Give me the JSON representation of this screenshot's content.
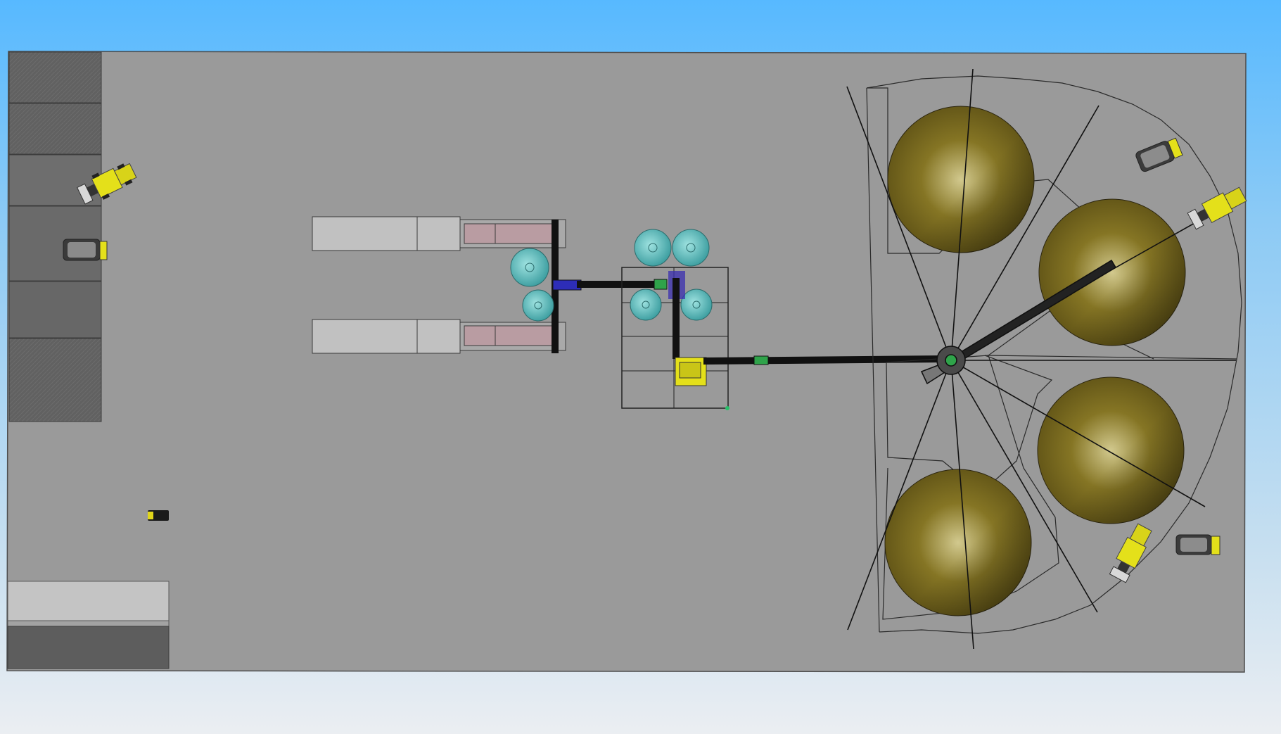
{
  "viewport": {
    "background_top": "#57b9ff",
    "background_bottom": "#ebeef2"
  },
  "model": {
    "floor_color": "#9a9a9a",
    "bay_color": "#5e5e5e",
    "panel_color": "#c1c1c1",
    "silo_color": "#7d7024",
    "tank_color": "#6ec8c6",
    "machine_color": "#e4e01a",
    "conveyor_color": "#111111",
    "elements": [
      "storage-bays",
      "front-loader",
      "haul-truck",
      "feed-hoppers",
      "water-tanks",
      "mixing-plant",
      "radial-stacker",
      "stockpile-silos",
      "office-building"
    ]
  }
}
